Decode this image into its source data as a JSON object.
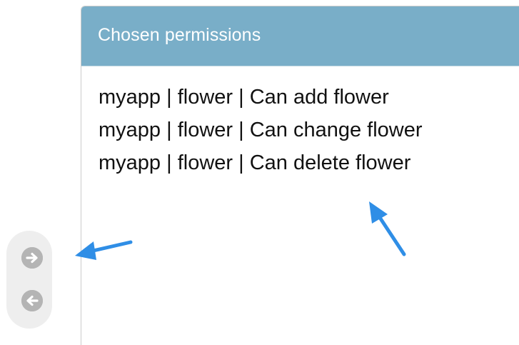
{
  "chosen_panel": {
    "title": "Chosen permissions",
    "options": [
      "myapp | flower | Can add flower",
      "myapp | flower | Can change flower",
      "myapp | flower | Can delete flower"
    ]
  },
  "move_controls": {
    "add_icon": "arrow-right-circle-icon",
    "remove_icon": "arrow-left-circle-icon"
  },
  "colors": {
    "header_background": "#79aec8",
    "header_text": "#ffffff",
    "annotation_arrow": "#2f8ee6",
    "move_button": "#b4b4b4"
  }
}
